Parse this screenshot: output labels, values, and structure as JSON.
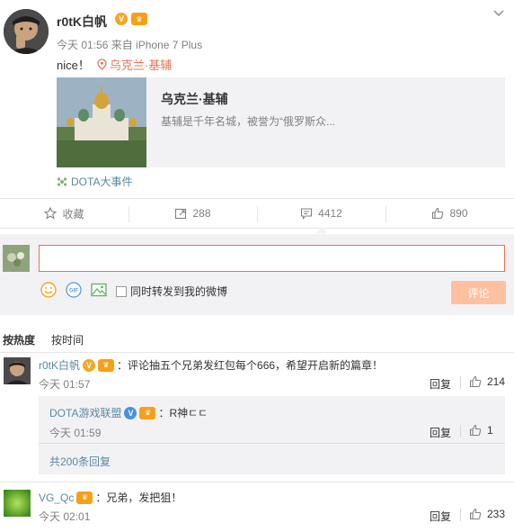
{
  "post": {
    "author": "r0tK白帆",
    "time": "今天 01:56",
    "source": "来自 iPhone 7 Plus",
    "text": "nice！",
    "location": "乌克兰·基辅",
    "card": {
      "title": "乌克兰·基辅",
      "description": "基辅是千年名城，被誉为“俄罗斯众..."
    },
    "topic": "DOTA大事件"
  },
  "actions": {
    "favorite": "收藏",
    "repost_count": "288",
    "comment_count": "4412",
    "like_count": "890"
  },
  "composer": {
    "input_value": "",
    "repost_option": "同时转发到我的微博",
    "submit": "评论"
  },
  "sort": {
    "by_hot": "按热度",
    "by_time": "按时间"
  },
  "comments": [
    {
      "name": "r0tK白帆",
      "text": "：评论抽五个兄弟发红包每个666，希望开启新的篇章！",
      "time": "今天 01:57",
      "reply": "回复",
      "likes": "214",
      "sub": {
        "name": "DOTA游戏联盟",
        "text": "：R神ㄷㄷ",
        "time": "今天 01:59",
        "reply": "回复",
        "likes": "1",
        "more": "共200条回复"
      }
    },
    {
      "name": "VG_Qc",
      "text": "：兄弟，发把狙！",
      "time": "今天 02:01",
      "reply": "回复",
      "likes": "233"
    }
  ],
  "colors": {
    "accent": "#eb7350",
    "link": "#5a8a9e",
    "muted": "#808080",
    "panel": "#f2f2f5"
  }
}
